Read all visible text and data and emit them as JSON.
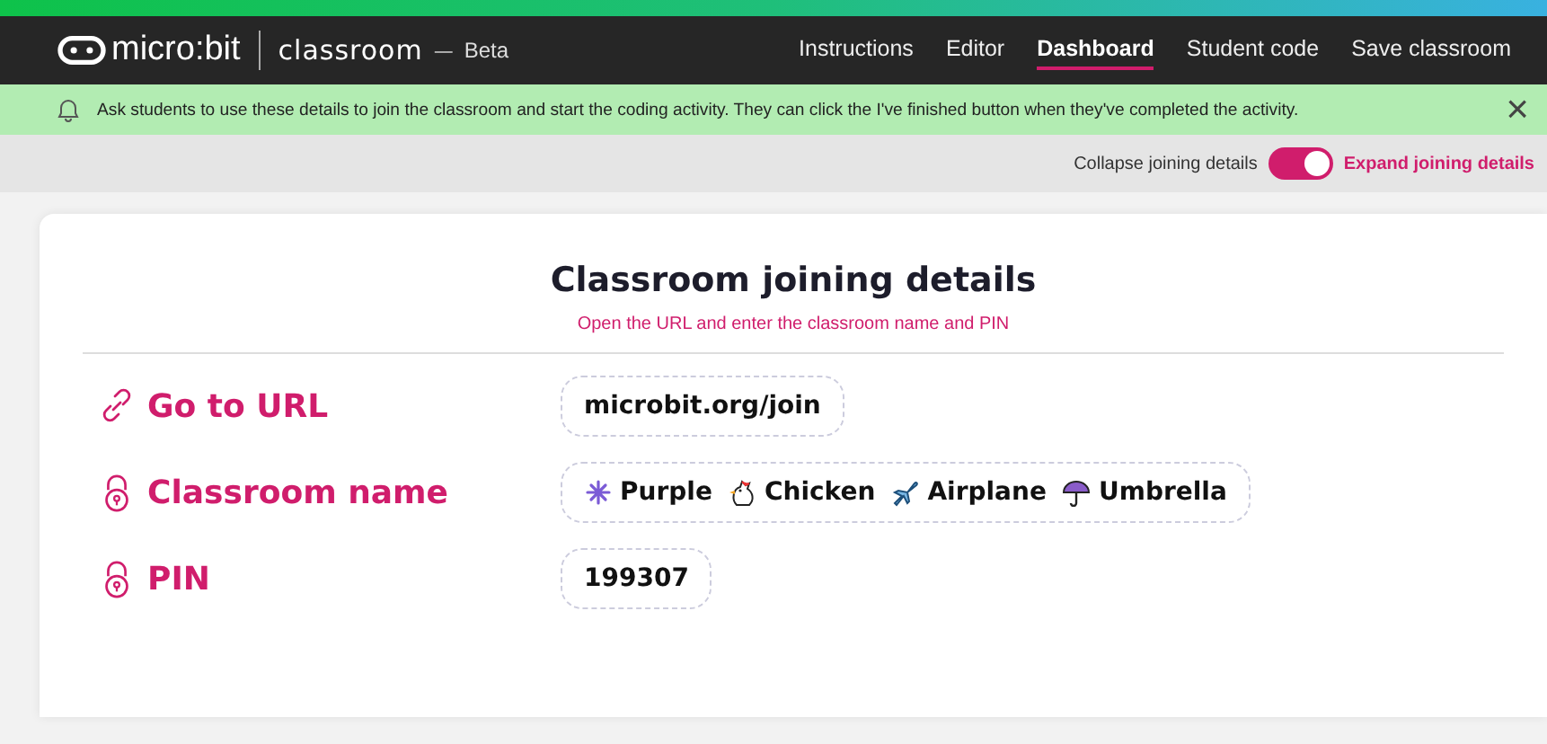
{
  "header": {
    "logo": "micro:bit",
    "product": "classroom",
    "separator": "—",
    "badge": "Beta",
    "nav": [
      {
        "label": "Instructions",
        "selected": false
      },
      {
        "label": "Editor",
        "selected": false
      },
      {
        "label": "Dashboard",
        "selected": true
      },
      {
        "label": "Student code",
        "selected": false
      },
      {
        "label": "Save classroom",
        "selected": false
      }
    ]
  },
  "banner": {
    "message": "Ask students to use these details to join the classroom and start the coding activity. They can click the I've finished button when they've completed the activity.",
    "close": "×"
  },
  "toggle": {
    "off_label": "Collapse joining details",
    "on_label": "Expand joining details",
    "on": true
  },
  "card": {
    "title": "Classroom joining details",
    "subtitle": "Open the URL and enter the classroom name and PIN",
    "rows": [
      {
        "kind": "link",
        "label": "Go to URL",
        "words": [
          {
            "text": "microbit.org/join"
          }
        ]
      },
      {
        "kind": "lock",
        "label": "Classroom name",
        "words": [
          {
            "kind": "sparkle",
            "text": "Purple"
          },
          {
            "kind": "chicken",
            "text": "Chicken"
          },
          {
            "kind": "airplane",
            "text": "Airplane"
          },
          {
            "kind": "umbrella",
            "text": "Umbrella"
          }
        ]
      },
      {
        "kind": "lock",
        "label": "PIN",
        "words": [
          {
            "text": "199307"
          }
        ]
      }
    ]
  }
}
